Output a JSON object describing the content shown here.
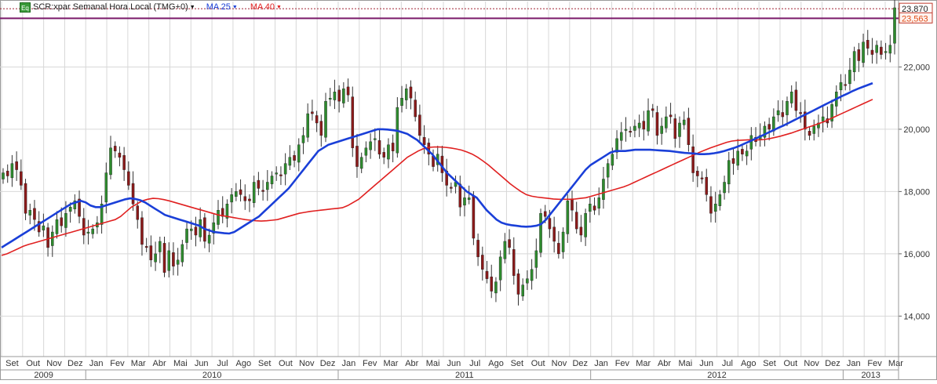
{
  "header": {
    "symbol_label": "SCR:xpar Semanal Hora Local (TMG+0)",
    "ma25_label": "MA 25",
    "ma40_label": "MA 40",
    "eq_icon": "Eq"
  },
  "colors": {
    "candle_up": "#2e8b2e",
    "candle_down": "#8b1a1a",
    "ma25": "#1a3fd8",
    "ma40": "#e02020",
    "grid": "#d8d8d8",
    "hline": "#7a1a6a"
  },
  "chart_data": {
    "type": "candlestick",
    "title": "SCR:xpar Semanal Hora Local (TMG+0)",
    "ylim": [
      12700,
      24100
    ],
    "y_ticks": [
      "14,000",
      "16,000",
      "18,000",
      "20,000",
      "22,000"
    ],
    "last_price_label": "23,870",
    "level_label": "23,563",
    "months": [
      "Set",
      "Out",
      "Nov",
      "Dez",
      "Jan",
      "Fev",
      "Mar",
      "Abr",
      "Mai",
      "Jun",
      "Jul",
      "Ago",
      "Set",
      "Out",
      "Nov",
      "Dez",
      "Jan",
      "Fev",
      "Mar",
      "Abr",
      "Mai",
      "Jun",
      "Jul",
      "Ago",
      "Set",
      "Out",
      "Nov",
      "Dez",
      "Jan",
      "Fev",
      "Mar",
      "Abr",
      "Mai",
      "Jun",
      "Jul",
      "Ago",
      "Set",
      "Out",
      "Nov",
      "Dez",
      "Jan",
      "Fev",
      "Mar"
    ],
    "years": [
      "2009",
      "2010",
      "2011",
      "2012",
      "2013"
    ],
    "close_series": [
      18600,
      18500,
      18900,
      18700,
      18200,
      17300,
      17400,
      17100,
      16700,
      16900,
      16200,
      16700,
      17100,
      16900,
      17300,
      17500,
      17700,
      17200,
      16600,
      16700,
      16800,
      17000,
      17600,
      18600,
      19400,
      19300,
      19100,
      18700,
      18200,
      17600,
      17100,
      16300,
      16200,
      15800,
      16000,
      16400,
      15400,
      16100,
      15600,
      15800,
      16300,
      16800,
      16800,
      16600,
      17100,
      16400,
      16600,
      17000,
      17400,
      17200,
      17600,
      17900,
      18000,
      17900,
      17700,
      17700,
      18300,
      18100,
      18000,
      18300,
      18500,
      18600,
      18500,
      18900,
      19100,
      19000,
      19500,
      19800,
      20500,
      20500,
      20200,
      19800,
      20900,
      21000,
      21200,
      20900,
      21300,
      21100,
      19400,
      18800,
      19100,
      19400,
      19600,
      19700,
      19200,
      19100,
      19500,
      19300,
      20700,
      21000,
      21300,
      21000,
      20400,
      19800,
      19500,
      19200,
      18800,
      19200,
      18600,
      18200,
      18100,
      18300,
      17500,
      17800,
      17800,
      16500,
      15900,
      15500,
      15200,
      14800,
      15100,
      15900,
      16400,
      16200,
      15300,
      14700,
      15000,
      15200,
      15500,
      16100,
      17300,
      17200,
      16800,
      16400,
      16000,
      16700,
      17700,
      17400,
      16800,
      16600,
      17300,
      17600,
      17400,
      17800,
      18400,
      18900,
      19200,
      19700,
      19900,
      20000,
      19900,
      20100,
      20200,
      20000,
      20600,
      20600,
      19800,
      20100,
      20400,
      20400,
      19700,
      20200,
      20300,
      19500,
      18600,
      18500,
      18400,
      17900,
      17300,
      17600,
      17900,
      18300,
      19000,
      18900,
      19300,
      19200,
      19300,
      19800,
      19600,
      19800,
      20100,
      20000,
      20400,
      20600,
      20400,
      20900,
      21200,
      20600,
      20500,
      20000,
      19800,
      20100,
      20200,
      20400,
      20200,
      20800,
      21200,
      21500,
      21400,
      21900,
      22500,
      22200,
      22800,
      22600,
      22400,
      22700,
      22400,
      22500,
      22700,
      23900
    ],
    "ma25_series": [
      16200,
      16300,
      16400,
      16500,
      16600,
      16700,
      16800,
      16900,
      17000,
      17100,
      17200,
      17300,
      17400,
      17500,
      17600,
      17650,
      17700,
      17650,
      17550,
      17500,
      17500,
      17550,
      17600,
      17650,
      17700,
      17750,
      17780,
      17760,
      17720,
      17650,
      17550,
      17450,
      17350,
      17250,
      17200,
      17150,
      17100,
      17050,
      17000,
      16950,
      16900,
      16800,
      16750,
      16700,
      16680,
      16660,
      16650,
      16700,
      16800,
      16900,
      17000,
      17100,
      17200,
      17350,
      17500,
      17650,
      17800,
      17950,
      18100,
      18300,
      18500,
      18700,
      18900,
      19100,
      19300,
      19400,
      19500,
      19550,
      19600,
      19650,
      19700,
      19750,
      19800,
      19850,
      19900,
      19950,
      20000,
      20000,
      19990,
      19970,
      19950,
      19900,
      19850,
      19750,
      19650,
      19500,
      19350,
      19200,
      19000,
      18800,
      18600,
      18450,
      18300,
      18150,
      18000,
      17900,
      17800,
      17600,
      17400,
      17250,
      17100,
      17000,
      16950,
      16920,
      16900,
      16880,
      16870,
      16880,
      16900,
      16950,
      17100,
      17300,
      17500,
      17700,
      17900,
      18100,
      18300,
      18500,
      18700,
      18850,
      18950,
      19050,
      19150,
      19250,
      19300,
      19300,
      19300,
      19320,
      19340,
      19340,
      19340,
      19340,
      19330,
      19320,
      19310,
      19300,
      19280,
      19260,
      19240,
      19230,
      19220,
      19200,
      19200,
      19210,
      19230,
      19260,
      19300,
      19350,
      19400,
      19460,
      19530,
      19600,
      19670,
      19750,
      19820,
      19900,
      19970,
      20050,
      20120,
      20200,
      20280,
      20360,
      20440,
      20520,
      20600,
      20680,
      20760,
      20840,
      20920,
      21000,
      21080,
      21150,
      21230,
      21300,
      21360,
      21420,
      21480
    ],
    "ma40_series": [
      15950,
      16000,
      16080,
      16160,
      16240,
      16300,
      16350,
      16400,
      16450,
      16500,
      16550,
      16600,
      16650,
      16700,
      16750,
      16800,
      16850,
      16900,
      16950,
      17000,
      17050,
      17100,
      17200,
      17350,
      17500,
      17600,
      17700,
      17750,
      17780,
      17770,
      17740,
      17700,
      17650,
      17600,
      17550,
      17500,
      17450,
      17400,
      17350,
      17300,
      17250,
      17220,
      17190,
      17160,
      17130,
      17100,
      17080,
      17060,
      17050,
      17060,
      17080,
      17100,
      17150,
      17200,
      17250,
      17300,
      17330,
      17360,
      17380,
      17400,
      17420,
      17440,
      17460,
      17480,
      17550,
      17650,
      17750,
      17900,
      18050,
      18200,
      18350,
      18500,
      18650,
      18800,
      18950,
      19100,
      19200,
      19300,
      19380,
      19420,
      19430,
      19430,
      19420,
      19400,
      19370,
      19330,
      19270,
      19200,
      19100,
      18980,
      18850,
      18700,
      18550,
      18400,
      18250,
      18120,
      18000,
      17900,
      17850,
      17820,
      17800,
      17780,
      17760,
      17750,
      17750,
      17750,
      17760,
      17780,
      17800,
      17850,
      17900,
      17950,
      18000,
      18050,
      18100,
      18150,
      18220,
      18300,
      18380,
      18460,
      18540,
      18620,
      18700,
      18780,
      18860,
      18940,
      19020,
      19100,
      19180,
      19260,
      19330,
      19400,
      19460,
      19520,
      19580,
      19620,
      19640,
      19650,
      19660,
      19660,
      19660,
      19670,
      19700,
      19740,
      19780,
      19830,
      19880,
      19940,
      20000,
      20060,
      20120,
      20180,
      20240,
      20320,
      20400,
      20480,
      20560,
      20640,
      20720,
      20800,
      20880,
      20960
    ]
  }
}
